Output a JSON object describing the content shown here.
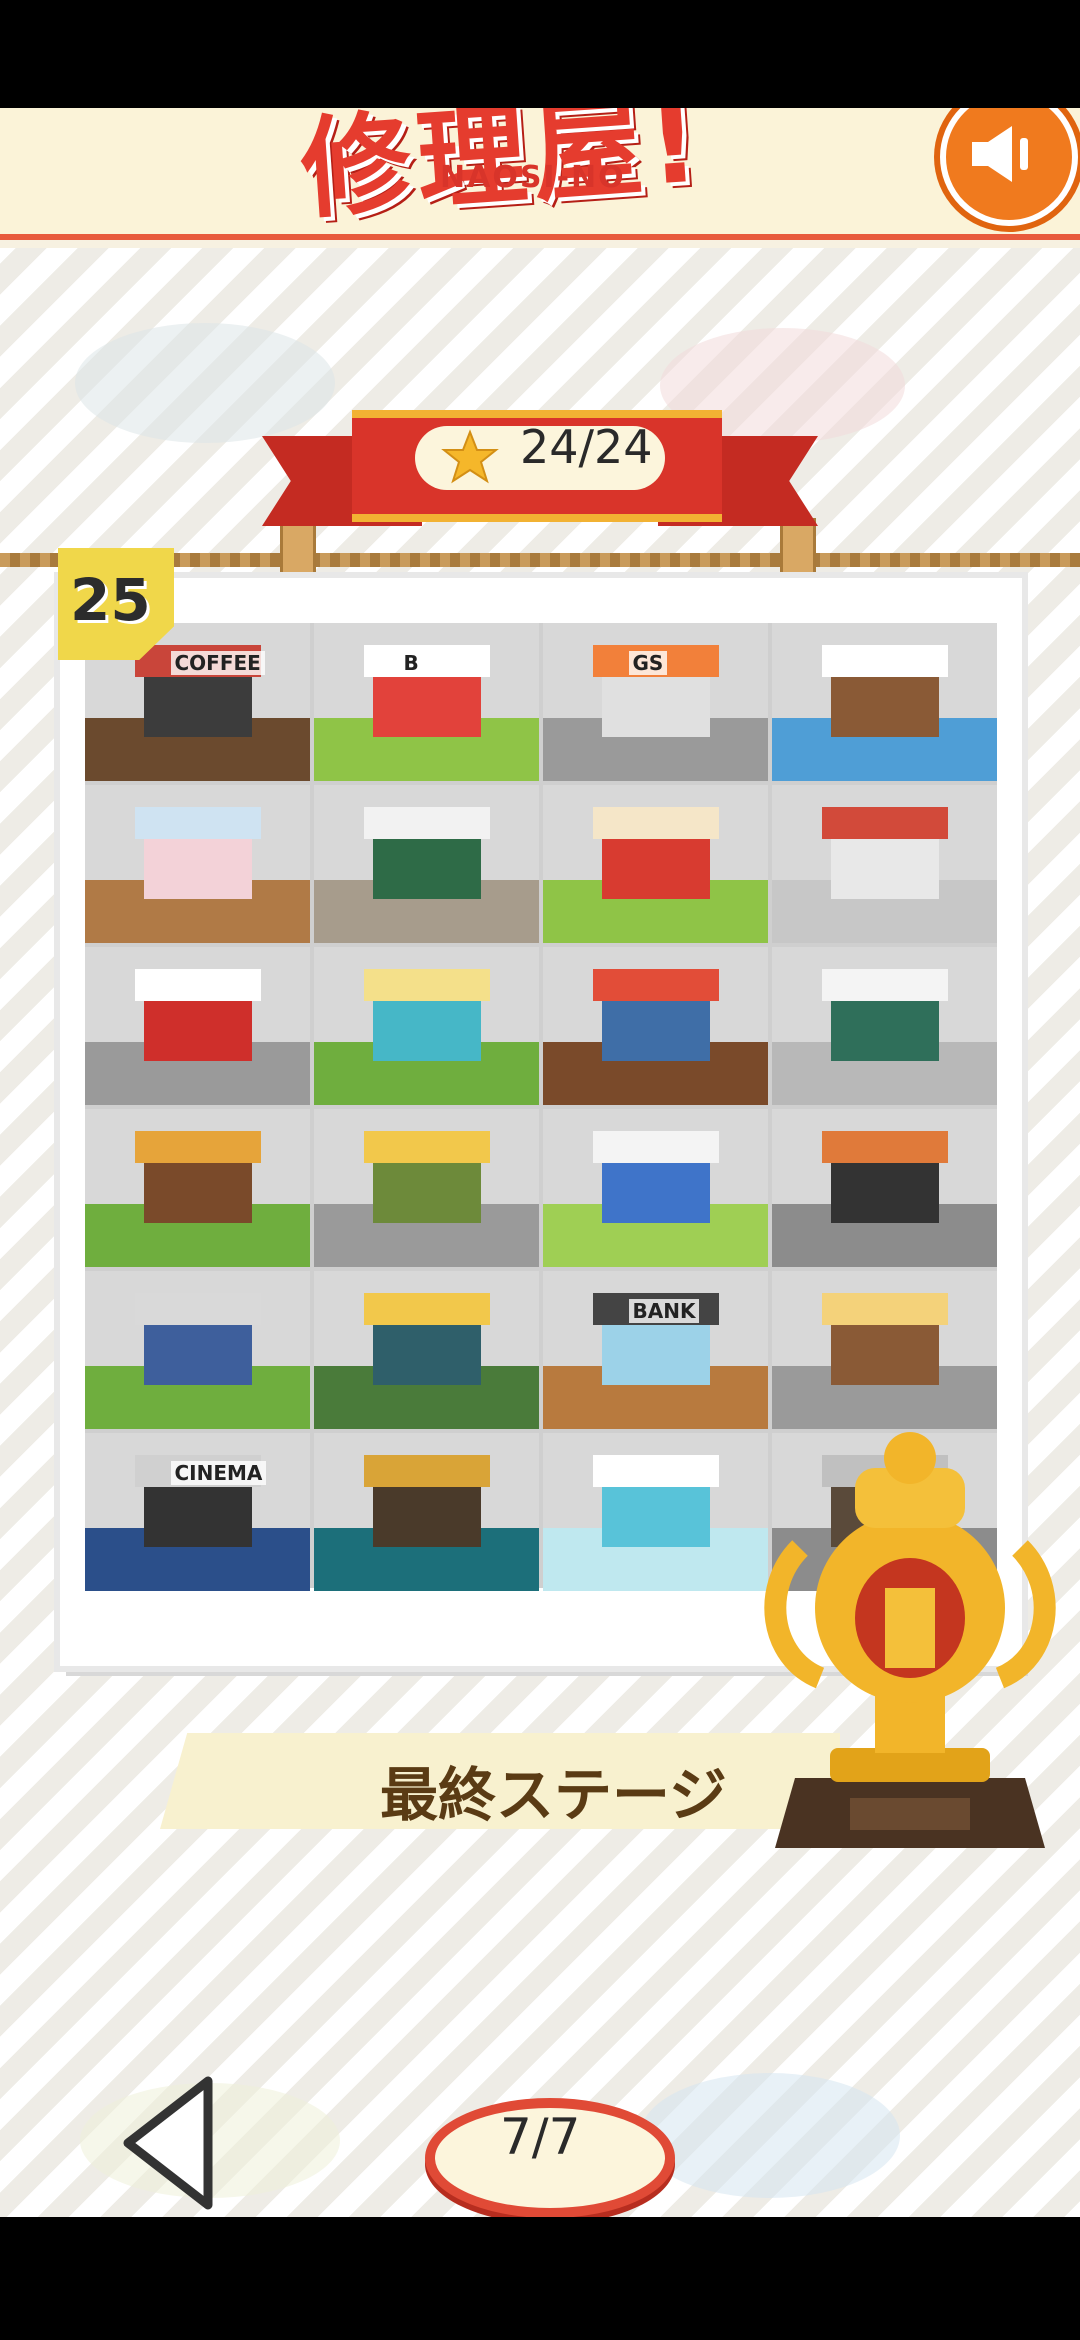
{
  "header": {
    "title_jp": "修理屋!",
    "title_en": "NAOSI-NO",
    "sound_icon": "speaker-icon"
  },
  "progress": {
    "stars_label": "24/24",
    "star_icon": "star-icon"
  },
  "album": {
    "stage_number": "25",
    "final_stage_label": "最終ステージ",
    "tiles": [
      {
        "name": "coffee-shop",
        "sign": "COFFEE",
        "ground": "#6b4a2e",
        "bldg": "#3c3c3c",
        "roof": "#c9453a"
      },
      {
        "name": "burger-shop",
        "sign": "B",
        "ground": "#8fc447",
        "bldg": "#e2423b",
        "roof": "#ffffff"
      },
      {
        "name": "gas-station",
        "sign": "GS",
        "ground": "#9a9a9a",
        "bldg": "#e0e0e0",
        "roof": "#f2803a"
      },
      {
        "name": "christmas-house",
        "sign": "",
        "ground": "#4f9ed6",
        "bldg": "#8a5a36",
        "roof": "#ffffff"
      },
      {
        "name": "arcade",
        "sign": "",
        "ground": "#b07a46",
        "bldg": "#f3d2d8",
        "roof": "#cfe3f2"
      },
      {
        "name": "flower-shop",
        "sign": "",
        "ground": "#a79c8c",
        "bldg": "#2e6b47",
        "roof": "#f2f2f2"
      },
      {
        "name": "circus-tent",
        "sign": "",
        "ground": "#8fc447",
        "bldg": "#d83b30",
        "roof": "#f5e6c8"
      },
      {
        "name": "cashier-shop",
        "sign": "",
        "ground": "#c7c7c7",
        "bldg": "#e8e8e8",
        "roof": "#d24a3a"
      },
      {
        "name": "post-office",
        "sign": "",
        "ground": "#9a9a9a",
        "bldg": "#cf2f2b",
        "roof": "#ffffff"
      },
      {
        "name": "power-station",
        "sign": "",
        "ground": "#6fae3e",
        "bldg": "#46b7c7",
        "roof": "#f4e08a"
      },
      {
        "name": "festival-stalls",
        "sign": "",
        "ground": "#7a4a2a",
        "bldg": "#3f6ea7",
        "roof": "#e24d38"
      },
      {
        "name": "market-stand",
        "sign": "",
        "ground": "#b8b8b8",
        "bldg": "#2f6f5a",
        "roof": "#f4f4f4"
      },
      {
        "name": "barn-house",
        "sign": "",
        "ground": "#6fae3e",
        "bldg": "#7a4a2a",
        "roof": "#e6a43a"
      },
      {
        "name": "noodle-shop",
        "sign": "",
        "ground": "#9a9a9a",
        "bldg": "#6d8a3a",
        "roof": "#f2c84b"
      },
      {
        "name": "egg-factory",
        "sign": "",
        "ground": "#9fcf54",
        "bldg": "#3f74c9",
        "roof": "#f4f4f4"
      },
      {
        "name": "cafe-corner",
        "sign": "",
        "ground": "#8c8c8c",
        "bldg": "#333333",
        "roof": "#e07a3a"
      },
      {
        "name": "apartment",
        "sign": "",
        "ground": "#6fae3e",
        "bldg": "#3e5f9c",
        "roof": "#d9d9d9"
      },
      {
        "name": "bathhouse",
        "sign": "",
        "ground": "#4a7b3a",
        "bldg": "#2f5f6a",
        "roof": "#f2c84b"
      },
      {
        "name": "bank",
        "sign": "BANK",
        "ground": "#b87a3e",
        "bldg": "#9cd2e8",
        "roof": "#444444"
      },
      {
        "name": "train-diner",
        "sign": "",
        "ground": "#9a9a9a",
        "bldg": "#8a5a36",
        "roof": "#f4d27a"
      },
      {
        "name": "cinema",
        "sign": "CINEMA",
        "ground": "#2b4f8a",
        "bldg": "#333333",
        "roof": "#d0d0d0"
      },
      {
        "name": "record-shop",
        "sign": "",
        "ground": "#1c6f7a",
        "bldg": "#4a3a2a",
        "roof": "#d9a437"
      },
      {
        "name": "aquarium",
        "sign": "",
        "ground": "#bfe8ef",
        "bldg": "#58c3d9",
        "roof": "#ffffff"
      },
      {
        "name": "locked-final",
        "sign": "",
        "ground": "#8c8c8c",
        "bldg": "#5a4a3a",
        "roof": "#c0c0c0"
      }
    ]
  },
  "trophy": {
    "icon": "trophy-icon"
  },
  "pagination": {
    "page_label": "7/7",
    "prev_icon": "arrow-left-icon"
  },
  "colors": {
    "accent_red": "#d9342a",
    "gold": "#f2b233",
    "orange": "#f07a1e"
  }
}
